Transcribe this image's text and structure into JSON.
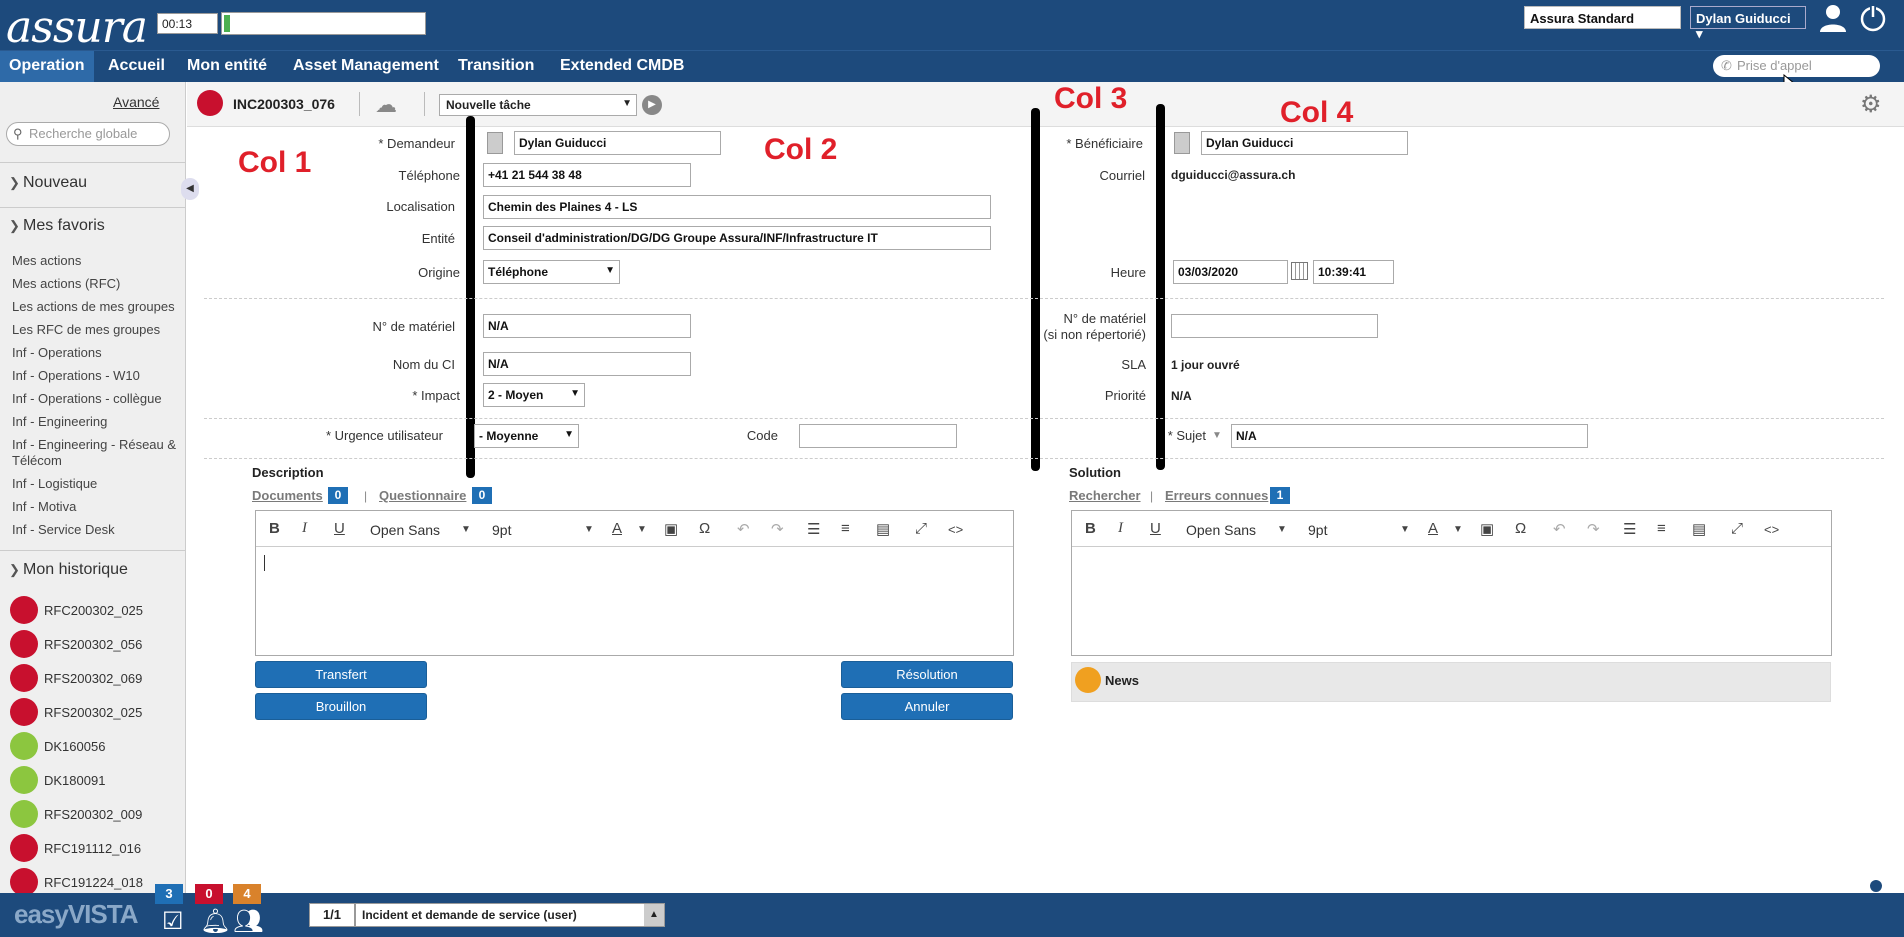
{
  "header": {
    "logo": "assura",
    "timer": "00:13",
    "progress": 0.03,
    "profile": "Assura Standard",
    "user": "Dylan Guiducci",
    "user_arrow": "▾"
  },
  "nav": {
    "items": [
      "Operation",
      "Accueil",
      "Mon entité",
      "Asset Management",
      "Transition",
      "Extended CMDB"
    ],
    "active": "Operation",
    "phone_placeholder": "Prise d'appel"
  },
  "sidebar": {
    "advanced": "Avancé",
    "search_placeholder": "Recherche globale",
    "new_label": "Nouveau",
    "favorites_label": "Mes favoris",
    "favorites": [
      "Mes actions",
      "Mes actions (RFC)",
      "Les actions de mes groupes",
      "Les RFC de mes groupes",
      "Inf - Operations",
      "Inf - Operations - W10",
      "Inf - Operations - collègue",
      "Inf - Engineering",
      "Inf - Engineering - Réseau &",
      "Télécom",
      "Inf - Logistique",
      "Inf - Motiva",
      "Inf - Service Desk"
    ],
    "history_label": "Mon historique",
    "history": [
      {
        "label": "RFC200302_025",
        "color": "red"
      },
      {
        "label": "RFS200302_056",
        "color": "red"
      },
      {
        "label": "RFS200302_069",
        "color": "red"
      },
      {
        "label": "RFS200302_025",
        "color": "red"
      },
      {
        "label": "DK160056",
        "color": "green"
      },
      {
        "label": "DK180091",
        "color": "green"
      },
      {
        "label": "RFS200302_009",
        "color": "green"
      },
      {
        "label": "RFC191112_016",
        "color": "red"
      },
      {
        "label": "RFC191224_018",
        "color": "red"
      }
    ]
  },
  "toolbar": {
    "incident": "INC200303_076",
    "task": "Nouvelle tâche"
  },
  "annotations": {
    "col1": "Col 1",
    "col2": "Col 2",
    "col3": "Col 3",
    "col4": "Col 4"
  },
  "form": {
    "demandeur_label": "* Demandeur",
    "demandeur": "Dylan Guiducci",
    "telephone_label": "Téléphone",
    "telephone": "+41 21 544 38 48",
    "localisation_label": "Localisation",
    "localisation": "Chemin des Plaines 4 - LS",
    "entite_label": "Entité",
    "entite": "Conseil d'administration/DG/DG Groupe Assura/INF/Infrastructure IT",
    "origine_label": "Origine",
    "origine": "Téléphone",
    "beneficiaire_label": "* Bénéficiaire",
    "beneficiaire": "Dylan Guiducci",
    "courriel_label": "Courriel",
    "courriel": "dguiducci@assura.ch",
    "heure_label": "Heure",
    "date": "03/03/2020",
    "time": "10:39:41",
    "materiel_label": "N° de matériel",
    "materiel": "N/A",
    "materiel2_label1": "N° de matériel",
    "materiel2_label2": "(si non répertorié)",
    "materiel2": "",
    "nomci_label": "Nom du CI",
    "nomci": "N/A",
    "sla_label": "SLA",
    "sla": "1 jour ouvré",
    "impact_label": "* Impact",
    "impact": "2 - Moyen",
    "priorite_label": "Priorité",
    "priorite": "N/A",
    "urgence_label": "* Urgence utilisateur",
    "urgence": "- Moyenne",
    "code_label": "Code",
    "code": "",
    "sujet_label": "* Sujet",
    "sujet": "N/A"
  },
  "description": {
    "title": "Description",
    "documents": "Documents",
    "documents_count": "0",
    "sep": "|",
    "questionnaire": "Questionnaire",
    "questionnaire_count": "0",
    "font": "Open Sans",
    "size": "9pt"
  },
  "solution": {
    "title": "Solution",
    "rechercher": "Rechercher",
    "sep": "|",
    "erreurs": "Erreurs connues",
    "erreurs_count": "1",
    "font": "Open Sans",
    "size": "9pt"
  },
  "buttons": {
    "transfert": "Transfert",
    "brouillon": "Brouillon",
    "resolution": "Résolution",
    "annuler": "Annuler"
  },
  "news": "News",
  "footer": {
    "logo": "easyVISTA",
    "badge1": "3",
    "badge2": "0",
    "badge3": "4",
    "count": "1/1",
    "desc": "Incident et demande de service (user)"
  },
  "colors": {
    "nav_bg": "#1d4a7c",
    "button": "#1f6fb5",
    "annotation": "#e0202a"
  }
}
